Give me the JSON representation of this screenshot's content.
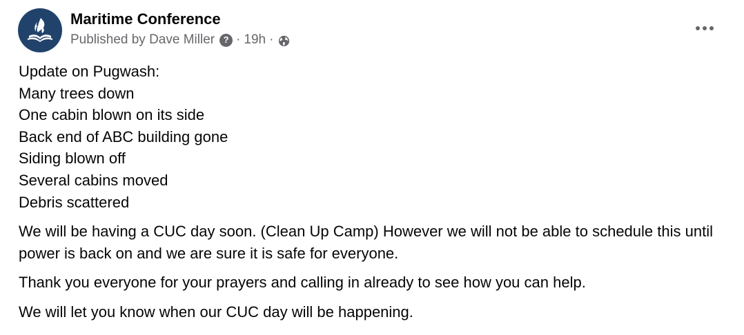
{
  "post": {
    "author": {
      "name": "Maritime Conference",
      "avatar_icon": "flame-bible-logo-icon",
      "avatar_color": "#21436b"
    },
    "published_by": "Published by Dave Miller",
    "help_icon": "question-icon",
    "help_glyph": "?",
    "separator": "·",
    "time": "19h",
    "audience_icon": "globe-icon",
    "more_icon": "more-horizontal-icon",
    "lines": [
      "Update on Pugwash:",
      "Many trees down",
      "One cabin blown on its side",
      "Back end of ABC building gone",
      "Siding blown off",
      "Several cabins moved",
      "Debris scattered"
    ],
    "paragraphs": [
      "We will be having a CUC day soon. (Clean Up Camp) However we will not be able to schedule this until power is back on and we are sure it is safe for everyone.",
      "Thank you everyone for your prayers and calling in already to see how you can help.",
      "We will let you know when our CUC day will be happening."
    ]
  }
}
